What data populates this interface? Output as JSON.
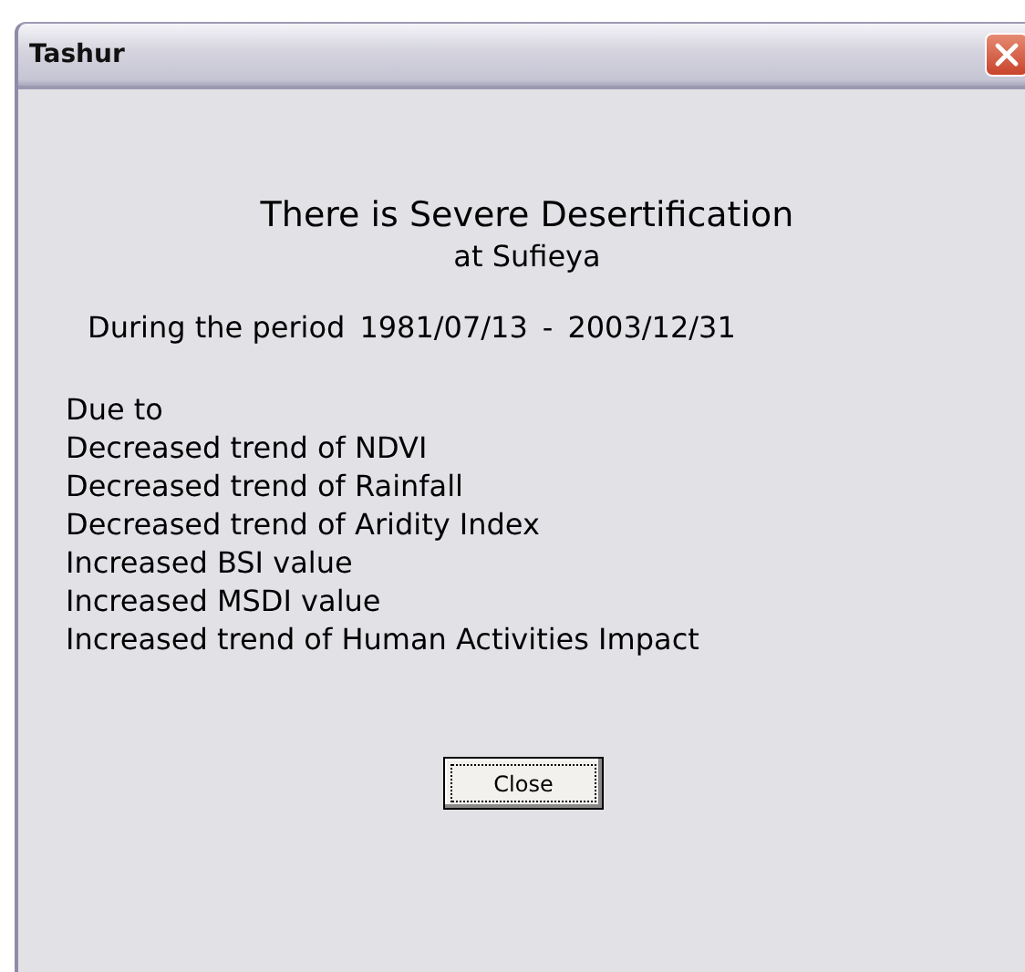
{
  "window": {
    "title": "Tashur"
  },
  "heading": "There is Severe Desertification",
  "subheading": "at Sufieya",
  "period": {
    "label": "During the  period",
    "start": "1981/07/13",
    "separator": "-",
    "end": "2003/12/31"
  },
  "reasons": [
    "Due to",
    "Decreased trend of NDVI",
    "Decreased trend of Rainfall",
    "Decreased trend of Aridity Index",
    "Increased BSI value",
    "Increased MSDI value",
    "Increased trend of Human Activities Impact"
  ],
  "buttons": [
    {
      "label": "Close",
      "focused": true
    }
  ]
}
